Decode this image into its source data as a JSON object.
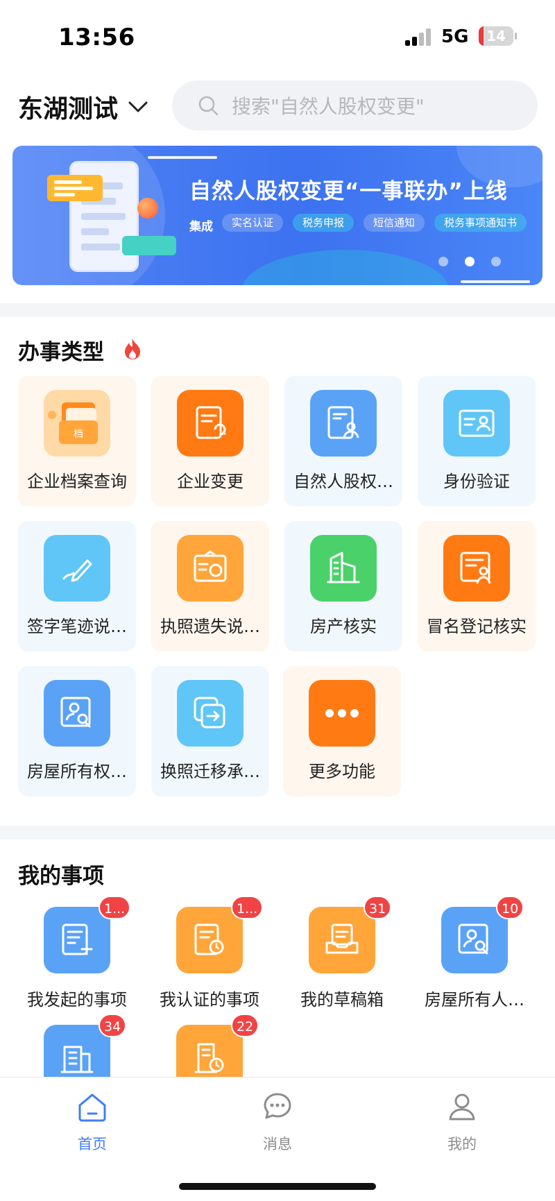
{
  "status_bar": {
    "time": "13:56",
    "network": "5G",
    "battery": "14",
    "battery_level": 0.14
  },
  "header": {
    "city": "东湖测试",
    "search_placeholder": "搜索\"自然人股权变更\""
  },
  "banner": {
    "title": "自然人股权变更“一事联办”上线",
    "prefix": "集成",
    "tags": [
      "实名认证",
      "税务申报",
      "短信通知",
      "税务事项通知书"
    ],
    "pages": 3,
    "active_page": 2
  },
  "services": {
    "title": "办事类型",
    "items": [
      {
        "label": "企业档案查询",
        "icon": "archive-icon",
        "color": "#ffa53a"
      },
      {
        "label": "企业变更",
        "icon": "document-refresh-icon",
        "color": "#ff7a12"
      },
      {
        "label": "自然人股权…",
        "icon": "document-person-icon",
        "color": "#5aa2f6"
      },
      {
        "label": "身份验证",
        "icon": "id-card-icon",
        "color": "#5fc6f7"
      },
      {
        "label": "签字笔迹说…",
        "icon": "signature-pen-icon",
        "color": "#5fc6f7"
      },
      {
        "label": "执照遗失说…",
        "icon": "license-stamp-icon",
        "color": "#ffa53a"
      },
      {
        "label": "房产核实",
        "icon": "building-icon",
        "color": "#4bd16a"
      },
      {
        "label": "冒名登记核实",
        "icon": "document-person-icon",
        "color": "#ff7a12"
      },
      {
        "label": "房屋所有权…",
        "icon": "person-search-icon",
        "color": "#5aa2f6"
      },
      {
        "label": "换照迁移承…",
        "icon": "transfer-icon",
        "color": "#5fc6f7"
      },
      {
        "label": "更多功能",
        "icon": "more-dots-icon",
        "color": "#ff7a12"
      }
    ]
  },
  "my_items": {
    "title": "我的事项",
    "items": [
      {
        "label": "我发起的事项",
        "badge": "1...",
        "icon": "document-add-icon"
      },
      {
        "label": "我认证的事项",
        "badge": "1...",
        "icon": "document-clock-icon"
      },
      {
        "label": "我的草稿箱",
        "badge": "31",
        "icon": "inbox-tray-icon"
      },
      {
        "label": "房屋所有人…",
        "badge": "10",
        "icon": "person-search-icon"
      },
      {
        "label": "",
        "badge": "34",
        "icon": "building-icon"
      },
      {
        "label": "",
        "badge": "22",
        "icon": "building-clock-icon"
      }
    ]
  },
  "tabbar": {
    "tabs": [
      {
        "label": "首页",
        "icon": "home-icon",
        "active": true
      },
      {
        "label": "消息",
        "icon": "message-icon",
        "active": false
      },
      {
        "label": "我的",
        "icon": "user-icon",
        "active": false
      }
    ]
  }
}
